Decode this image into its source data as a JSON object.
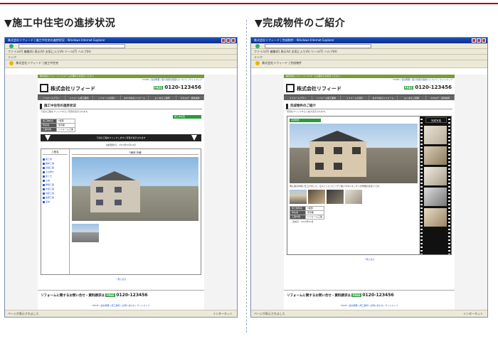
{
  "left": {
    "heading": "▼施工中住宅の進捗状況",
    "window_title": "株式会社リフィード | 施工中住宅の進捗状況 - Windows Internet Explorer",
    "menubar": "ファイル(F)  編集(E)  表示(V)  お気に入り(A)  ツール(T)  ヘルプ(H)",
    "address": "http://www.reafeed.com/construction/progress.php",
    "links": "リンク",
    "tab": "株式会社リフィード | 施工中住宅",
    "site": {
      "banner": "株式会社リフィード  リフォームの事ならお任せください",
      "toplinks": "HOME | 会社概要 | 個人情報の取扱いについて | サイトマップ",
      "company": "株式会社リフィード",
      "tel": "0120-123456",
      "free": "FREE",
      "nav": [
        "リフォームプラン",
        "リフォーム施工事例",
        "リフォームの流れ",
        "おすすめのリフォーム",
        "よくあるご質問",
        "カタログ・資料請求"
      ],
      "page_title": "施工中住宅の進捗状況",
      "intro": "下記の工程をクリックすると写真が表示されます。",
      "badge": "施工中住宅",
      "info_rows": [
        {
          "key": "施工物件名",
          "value": "T様邸"
        },
        {
          "key": "所在地",
          "value": "東京都"
        },
        {
          "key": "工事内容",
          "value": "リフォーム工事"
        }
      ],
      "bar_text": "下記の工程をクリックしますと写真が表示されます",
      "date": "最終更新日：2010年10月14日",
      "viewer_header": "工程名",
      "viewer_caption": "T様邸 外観",
      "steps": [
        "着工前",
        "解体工事",
        "基礎工事",
        "土台敷き",
        "建て方",
        "上棟",
        "屋根工事",
        "外壁工事",
        "内装工事",
        "設備工事",
        "完成"
      ],
      "back_link": "一覧に戻る",
      "footer_label": "リフォームに関するお問い合せ・資料請求は",
      "footer_tel": "0120-123456",
      "footer_links": "HOME | 会社概要 | 施工事例 | お問い合わせ | サイトマップ"
    },
    "status": "ページが表示されました",
    "zone": "インターネット"
  },
  "right": {
    "heading": "▼完成物件のご紹介",
    "window_title": "株式会社リフィード | 完成物件 - Windows Internet Explorer",
    "menubar": "ファイル(F)  編集(E)  表示(V)  お気に入り(A)  ツール(T)  ヘルプ(H)",
    "address": "http://www.reafeed.com/completion/index.php",
    "links": "リンク",
    "tab": "株式会社リフィード | 完成物件",
    "site": {
      "banner": "株式会社リフィード  リフォームの事ならお任せください",
      "toplinks": "HOME | 会社概要 | 個人情報の取扱いについて | サイトマップ",
      "company": "株式会社リフィード",
      "tel": "0120-123456",
      "free": "FREE",
      "nav": [
        "リフォームプラン",
        "リフォーム施工事例",
        "リフォームの流れ",
        "おすすめのリフォーム",
        "よくあるご質問",
        "カタログ・資料請求"
      ],
      "page_title": "完成物件のご紹介",
      "intro": "写真をクリックすると拡大表示されます。",
      "badge": "完成物件",
      "film_label": "完成写真",
      "desc": "南仏風の外観に仕上げました。広々としたリビングと使いやすいキッチンが特徴の住まいです。",
      "info_rows": [
        {
          "key": "施工物件名",
          "value": "T様邸"
        },
        {
          "key": "所在地",
          "value": "東京都"
        },
        {
          "key": "工事内容",
          "value": "リフォーム工事"
        }
      ],
      "date": "完成日：2010年10月",
      "back_link": "一覧に戻る",
      "footer_label": "リフォームに関するお問い合せ・資料請求は",
      "footer_tel": "0120-123456",
      "footer_links": "HOME | 会社概要 | 施工事例 | お問い合わせ | サイトマップ"
    },
    "status": "ページが表示されました",
    "zone": "インターネット"
  }
}
